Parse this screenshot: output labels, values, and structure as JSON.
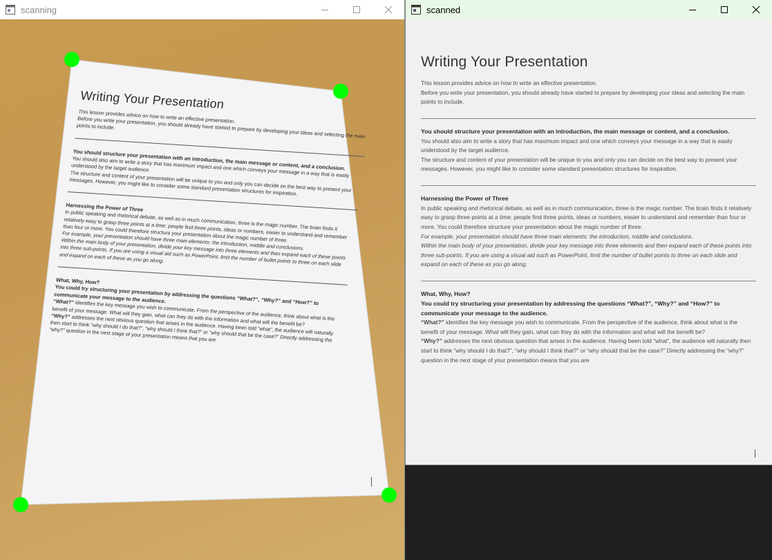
{
  "windows": {
    "left": {
      "title": "scanning"
    },
    "right": {
      "title": "scanned"
    }
  },
  "document": {
    "title": "Writing Your Presentation",
    "intro": [
      "This lesson provides advice on how to write an effective presentation.",
      "Before you write your presentation, you should already have started to prepare by developing your ideas and selecting the main points to include."
    ],
    "s1_heading": "You should structure your presentation with an introduction, the main message or content, and a conclusion.",
    "s1_p1": "You should also aim to write a story that has maximum impact and one which conveys your message in a way that is easily understood by the target audience.",
    "s1_p2": "The structure and content of your presentation will be unique to you and only you can decide on the best way to present your messages.  However, you might like to consider some standard presentation structures for inspiration.",
    "s2_heading": "Harnessing the Power of Three",
    "s2_p1": "In public speaking and rhetorical debate, as well as in much communication, three is the magic number.  The brain finds it relatively easy to grasp three points at a time: people find three points, ideas or numbers, easier to understand and remember than four or more.  You could therefore structure your presentation about the magic number of three.",
    "s2_i1": "For example, your presentation should have three main elements: the introduction, middle and conclusions.",
    "s2_i2": "Within the main body of your presentation, divide your key message into three elements and then expand each of these points into three sub-points.  If you are using a visual aid such as PowerPoint, limit the number of bullet points to three on each slide and expand on each of these as you go along.",
    "s3_heading": "What, Why, How?",
    "s3_lead": "You could try structuring your presentation by addressing the questions “What?”, “Why?” and “How?” to communicate your message to the audience.",
    "s3_what_label": "“What?”",
    "s3_what_text": " identifies the key message you wish to communicate.  From the perspective of the audience, think about what is the benefit of your message.  What will they gain, what can they do with the information and what will the benefit be?",
    "s3_why_label": "“Why?”",
    "s3_why_text": " addresses the next obvious question that arises in the audience.  Having been told “what”, the audience will naturally then start to think “why should I do that?”, “why should I think that?” or “why should that be the case?”  Directly addressing the “why?” question in the next stage of your presentation means that you are"
  },
  "colors": {
    "corner_marker": "#00ff00",
    "desk": "#c79a50",
    "active_titlebar": "#e8f8e8"
  },
  "icons": {
    "app": "window-app-icon",
    "minimize": "minimize-icon",
    "maximize": "maximize-icon",
    "close": "close-icon"
  }
}
